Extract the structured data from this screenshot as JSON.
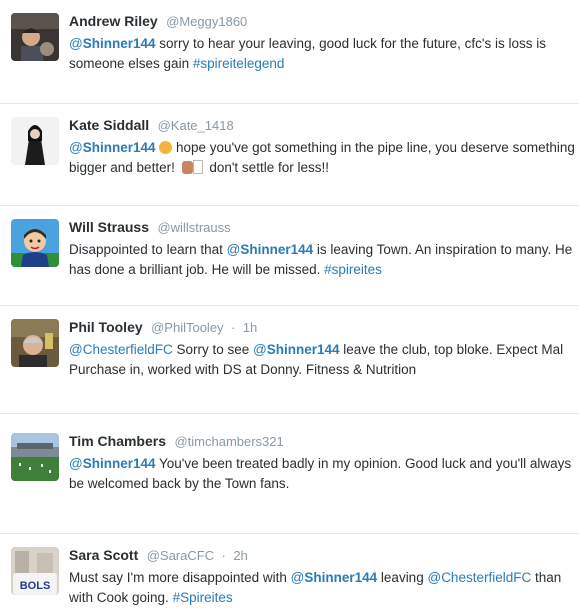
{
  "tweets": [
    {
      "name": "Andrew Riley",
      "handle": "@Meggy1860",
      "parts": [
        {
          "t": "mention",
          "at": "@",
          "user": "Shinner144"
        },
        {
          "t": "text",
          "v": " sorry to hear your leaving, good luck for the future, cfc's is loss is someone elses gain "
        },
        {
          "t": "hashtag",
          "v": "#spireitelegend"
        }
      ]
    },
    {
      "name": "Kate Siddall",
      "handle": "@Kate_1418",
      "parts": [
        {
          "t": "mention",
          "at": "@",
          "user": "Shinner144"
        },
        {
          "t": "text",
          "v": " "
        },
        {
          "t": "emoji",
          "v": "disappointed-face-emoji"
        },
        {
          "t": "text",
          "v": " hope you've got something in the pipe line, you deserve something bigger and better! "
        },
        {
          "t": "emoji",
          "v": "thumbs-up-emoji"
        },
        {
          "t": "emoji",
          "v": "missing-glyph-emoji"
        },
        {
          "t": "text",
          "v": " don't settle for less!!"
        }
      ]
    },
    {
      "name": "Will Strauss",
      "handle": "@willstrauss",
      "parts": [
        {
          "t": "text",
          "v": "Disappointed to learn that "
        },
        {
          "t": "mention",
          "at": "@",
          "user": "Shinner144"
        },
        {
          "t": "text",
          "v": " is leaving Town. An inspiration to many. He has done a brilliant job. He will be missed. "
        },
        {
          "t": "hashtag",
          "v": "#spireites"
        }
      ]
    },
    {
      "name": "Phil Tooley",
      "handle": "@PhilTooley",
      "time": "1h",
      "parts": [
        {
          "t": "mention",
          "at": "@",
          "user": "ChesterfieldFC",
          "plain": true
        },
        {
          "t": "text",
          "v": " Sorry to see "
        },
        {
          "t": "mention",
          "at": "@",
          "user": "Shinner144"
        },
        {
          "t": "text",
          "v": " leave the club, top bloke. Expect Mal Purchase in, worked with DS at Donny. Fitness & Nutrition"
        }
      ]
    },
    {
      "name": "Tim Chambers",
      "handle": "@timchambers321",
      "parts": [
        {
          "t": "mention",
          "at": "@",
          "user": "Shinner144"
        },
        {
          "t": "text",
          "v": " You've been treated badly in my opinion. Good luck and you'll always be welcomed back by the Town fans."
        }
      ]
    },
    {
      "name": "Sara Scott",
      "handle": "@SaraCFC",
      "time": "2h",
      "parts": [
        {
          "t": "text",
          "v": "Must say I'm more disappointed with "
        },
        {
          "t": "mention",
          "at": "@",
          "user": "Shinner144"
        },
        {
          "t": "text",
          "v": " leaving "
        },
        {
          "t": "mention",
          "at": "@",
          "user": "ChesterfieldFC",
          "plain": true
        },
        {
          "t": "text",
          "v": " than with Cook going. "
        },
        {
          "t": "hashtag",
          "v": "#Spireites"
        }
      ]
    }
  ],
  "time_separator": "·",
  "avatar_bottle_label": "BOLS",
  "colors": {
    "link": "#2b7bb9",
    "muted": "#8899a6",
    "text": "#292f33",
    "divider": "#e1e8ed"
  }
}
